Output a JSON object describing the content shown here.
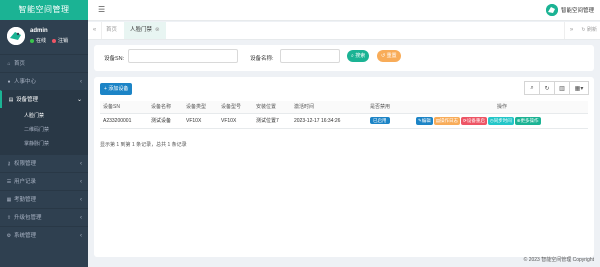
{
  "app": {
    "brand": "智能空间管理"
  },
  "profile": {
    "name": "admin",
    "online": "在线",
    "logout": "注销"
  },
  "sidebar": {
    "items": [
      {
        "label": "首页",
        "icon": "home-icon"
      },
      {
        "label": "人事中心",
        "icon": "user-icon"
      },
      {
        "label": "设备管理",
        "icon": "device-icon"
      },
      {
        "label": "权限管理",
        "icon": "key-icon"
      },
      {
        "label": "用户记录",
        "icon": "list-icon"
      },
      {
        "label": "考勤管理",
        "icon": "calendar-icon"
      },
      {
        "label": "升级包管理",
        "icon": "upload-icon"
      },
      {
        "label": "系统管理",
        "icon": "gear-icon"
      }
    ],
    "sub_items": [
      {
        "label": "人脸门禁"
      },
      {
        "label": "二维码门禁"
      },
      {
        "label": "掌静脉门禁"
      }
    ]
  },
  "topbar": {
    "user": "智能空间管理"
  },
  "tabs": {
    "home": "首页",
    "current": "人脸门禁",
    "refresh": "刷新"
  },
  "search": {
    "sn_label": "设备SN:",
    "name_label": "设备名称:",
    "search_btn": "搜索",
    "reset_btn": "重置"
  },
  "toolbar": {
    "add": "添加设备"
  },
  "table": {
    "headers": [
      "设备SN",
      "设备名称",
      "设备类型",
      "设备型号",
      "安装位置",
      "激活时间",
      "是否禁用",
      "操作"
    ],
    "rows": [
      {
        "sn": "A233200001",
        "name": "测试设备",
        "type": "VF10X",
        "model": "VF10X",
        "location": "测试位置7",
        "activated": "2023-12-17 16:34:26",
        "status": "已启用",
        "ops": [
          "编辑",
          "操作日志",
          "设备重启",
          "同步时间",
          "更多操作"
        ]
      }
    ]
  },
  "pagination": {
    "info": "显示第 1 到第 1 条记录，总共 1 条记录"
  },
  "footer": {
    "copyright": "© 2023 智能空间管理 Copyright"
  }
}
